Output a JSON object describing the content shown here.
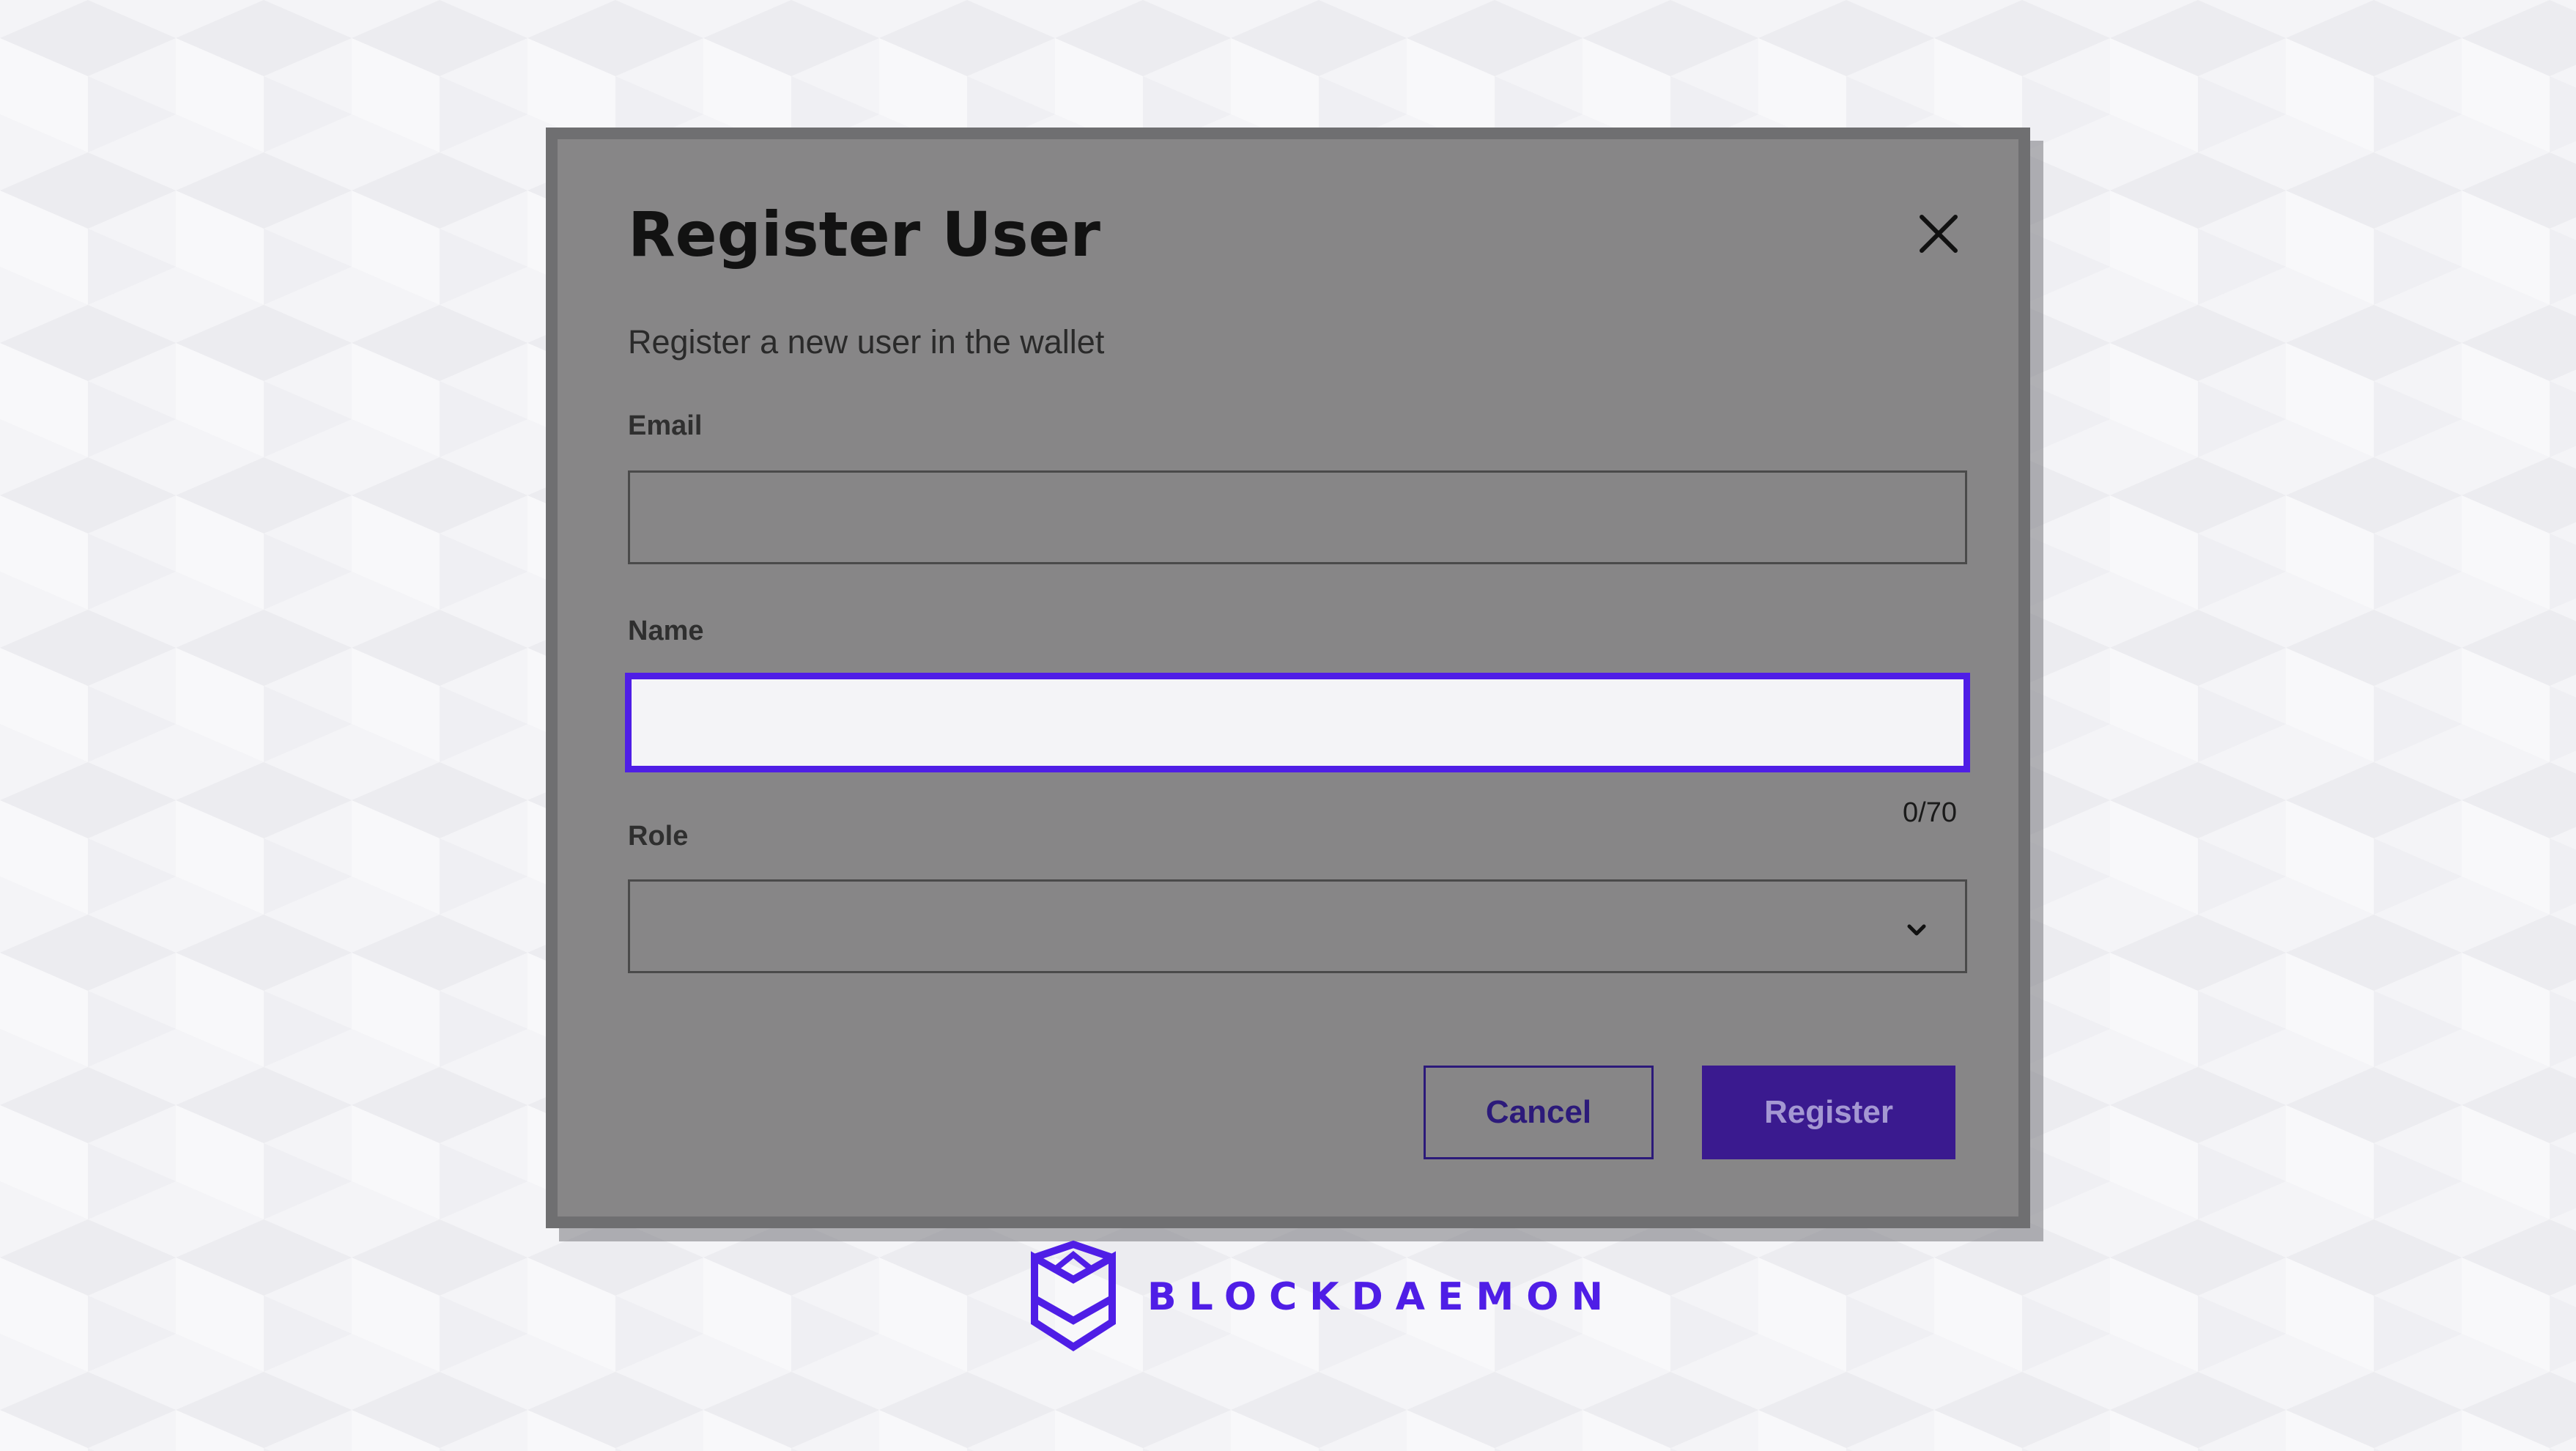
{
  "dialog": {
    "title": "Register User",
    "subtitle": "Register a new user in the wallet",
    "close_icon": "close-icon"
  },
  "form": {
    "email": {
      "label": "Email",
      "value": "",
      "placeholder": ""
    },
    "name": {
      "label": "Name",
      "value": "",
      "placeholder": "",
      "counter": "0/70",
      "focused": true
    },
    "role": {
      "label": "Role",
      "value": "",
      "icon": "chevron-down-icon"
    }
  },
  "actions": {
    "cancel_label": "Cancel",
    "register_label": "Register"
  },
  "brand": {
    "name": "BLOCKDAEMON",
    "logo_icon": "blockdaemon-logo-icon"
  },
  "colors": {
    "accent": "#4f1ee6",
    "primary_button": "#3a1a8f",
    "overlay": "#878687",
    "page_background": "#f4f4f7"
  }
}
